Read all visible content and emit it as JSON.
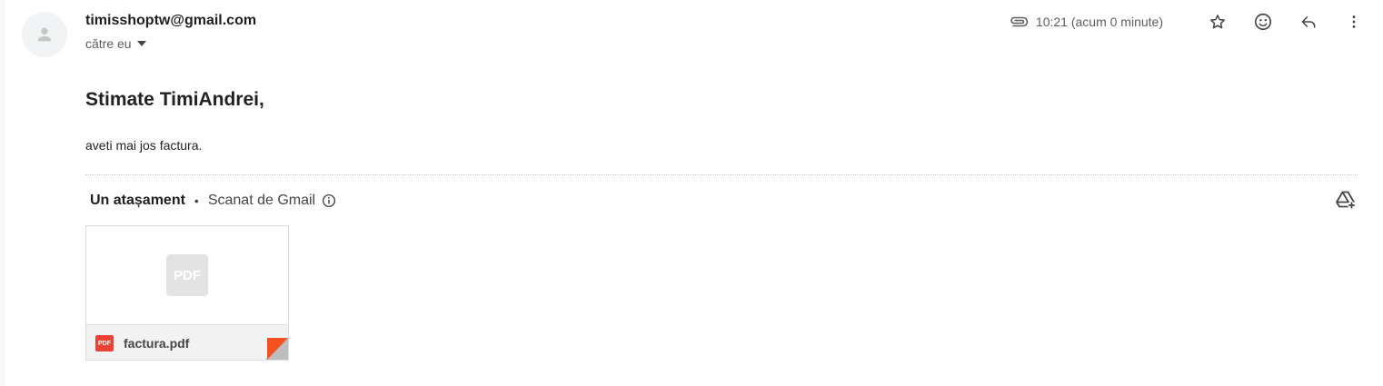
{
  "email": {
    "sender": "timisshoptw@gmail.com",
    "recipient_label": "către eu",
    "time": "10:21 (acum 0 minute)",
    "greeting": "Stimate TimiAndrei,",
    "body": "aveti mai jos factura."
  },
  "attachments": {
    "count_label": "Un atașament",
    "separator": "•",
    "scanned_label": "Scanat de Gmail",
    "items": [
      {
        "placeholder_label": "PDF",
        "badge": "PDF",
        "name": "factura.pdf"
      }
    ]
  },
  "icons": {
    "avatar": "person-icon",
    "attachment": "paperclip-icon",
    "star": "star-icon",
    "emoji": "smiley-icon",
    "reply": "reply-icon",
    "more": "more-vert-icon",
    "info": "info-icon",
    "drive_add": "add-to-drive-icon",
    "recipient_dropdown": "caret-down-icon"
  },
  "colors": {
    "pdf_red": "#ea4335",
    "text_secondary": "#5e5e5e"
  }
}
